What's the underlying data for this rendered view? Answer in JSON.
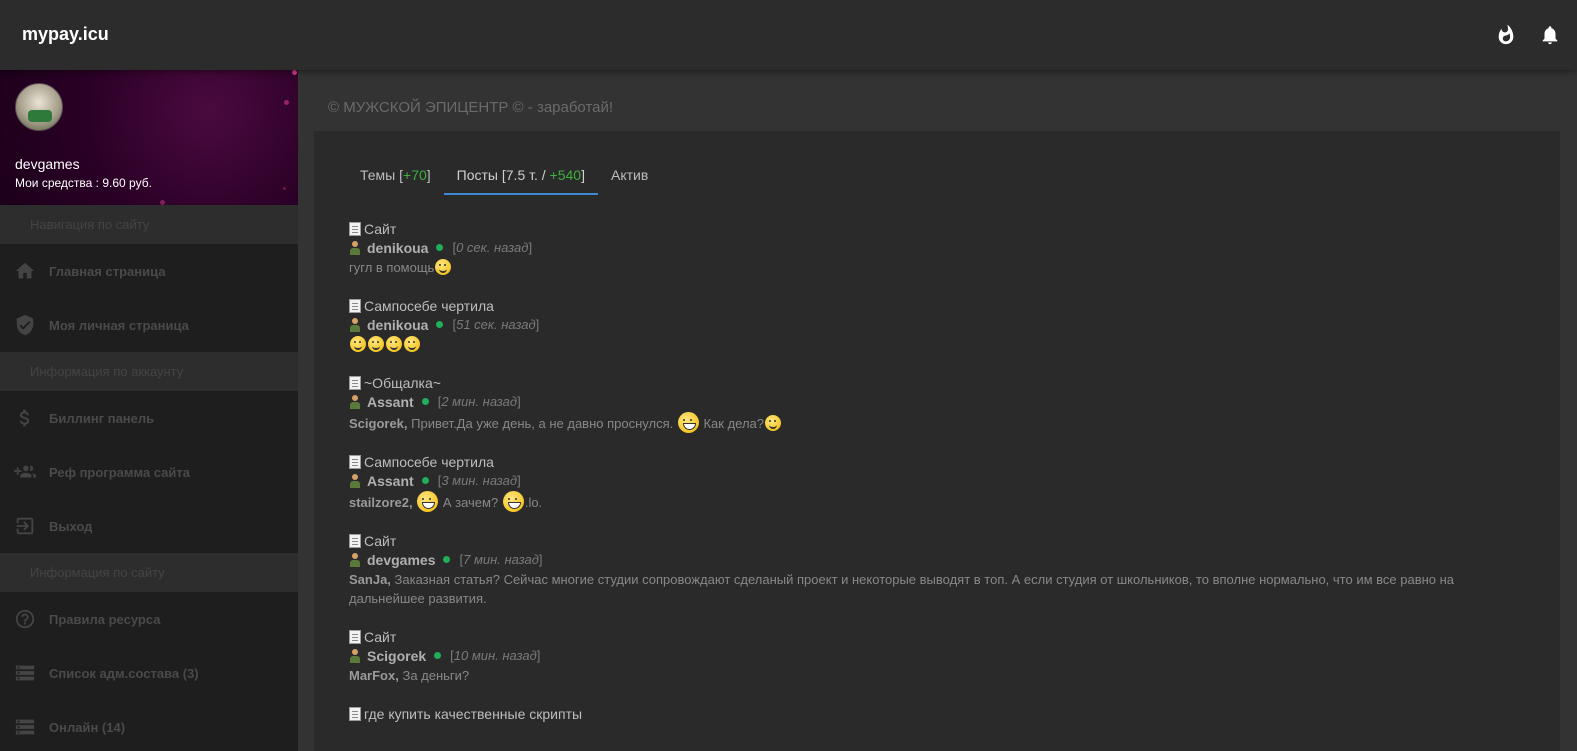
{
  "header": {
    "brand": "mypay.icu",
    "icons": [
      "fire-icon",
      "bell-icon"
    ]
  },
  "sidebar": {
    "username": "devgames",
    "funds": "Мои средства : 9.60 руб.",
    "sections": [
      {
        "header": "Навигация по сайту",
        "items": [
          {
            "label": "Главная страница",
            "icon": "home-icon"
          },
          {
            "label": "Моя личная страница",
            "icon": "shield-check-icon"
          }
        ]
      },
      {
        "header": "Информация по аккаунту",
        "items": [
          {
            "label": "Биллинг панель",
            "icon": "dollar-icon"
          },
          {
            "label": "Реф программа сайта",
            "icon": "group-add-icon"
          },
          {
            "label": "Выход",
            "icon": "exit-icon"
          }
        ]
      },
      {
        "header": "Информация по сайту",
        "items": [
          {
            "label": "Правила ресурса",
            "icon": "help-circle-icon"
          },
          {
            "label": "Список адм.состава (3)",
            "icon": "storage-icon"
          },
          {
            "label": "Онлайн (14)",
            "icon": "storage-icon"
          }
        ]
      }
    ]
  },
  "main": {
    "title": "© МУЖСКОЙ ЭПИЦЕНТР © - заработай!",
    "tabs": [
      {
        "label": "Темы [",
        "count": "+70",
        "suffix": "]"
      },
      {
        "label": "Посты [7.5 т. / ",
        "count": "+540",
        "suffix": "]"
      },
      {
        "label": "Актив"
      }
    ],
    "posts": [
      {
        "topic": "Сайт",
        "author": "denikoua",
        "time": "0 сек. назад",
        "reply_to": "",
        "text": "гугл в помощь"
      },
      {
        "topic": "Сампосебе чертила",
        "author": "denikoua",
        "time": "51 сек. назад",
        "reply_to": "",
        "text": ""
      },
      {
        "topic": "~Общалка~",
        "author": "Assant",
        "time": "2 мин. назад",
        "reply_to": "Scigorek,",
        "text": "Привет.Да уже день, а не давно проснулся.",
        "text2": "Как дела?"
      },
      {
        "topic": "Сампосебе чертила",
        "author": "Assant",
        "time": "3 мин. назад",
        "reply_to": "stailzore2,",
        "text": "А зачем?",
        "text2": ".lo."
      },
      {
        "topic": "Сайт",
        "author": "devgames",
        "time": "7 мин. назад",
        "reply_to": "SanJa,",
        "text": "Заказная статья? Сейчас многие студии сопровождают сделаный проект и некоторые выводят в топ. А если студия от школьников, то вполне нормально, что им все равно на дальнейшее развития."
      },
      {
        "topic": "Сайт",
        "author": "Scigorek",
        "time": "10 мин. назад",
        "reply_to": "MarFox,",
        "text": "За деньги?"
      },
      {
        "topic": "где купить качественные скрипты"
      }
    ]
  }
}
